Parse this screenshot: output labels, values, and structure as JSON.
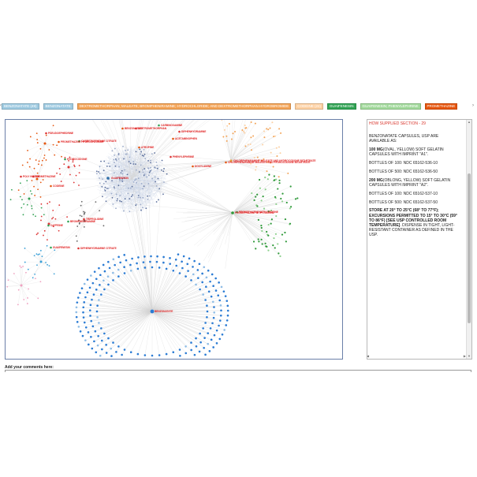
{
  "tags": [
    {
      "label": "BENZONATATE (49)",
      "color": "#9ecae1"
    },
    {
      "label": "BENZONATATE",
      "color": "#9ecae1"
    },
    {
      "label": "DEXTROMETHORPHAN; MALEATE; BROMPHENIRAMINE; HYDROCHLORIDE; AND DEXTROMETHORPHAN HYDROBROMIDE",
      "color": "#f3a356"
    },
    {
      "label": "CODEINE (22)",
      "color": "#fdd0a2"
    },
    {
      "label": "GUAIFENESIN",
      "color": "#31a354"
    },
    {
      "label": "GUAIFENESIN; PHENYLEPHRINE",
      "color": "#a1d99b"
    },
    {
      "label": "PROMETHAZINE",
      "color": "#e6550d"
    }
  ],
  "graph": {
    "hubs": [
      {
        "id": "h_benzo",
        "label": "BENZONATATE",
        "color": "#2a7bd4"
      },
      {
        "id": "h_guai",
        "label": "GUAIFENESIN",
        "color": "#2f6fa8"
      },
      {
        "id": "h_prom_cod",
        "label": "PROMETHAZINE WITH CODEINE",
        "color": "#2f9a3a"
      },
      {
        "id": "h_chlor",
        "label": "CHLORPHENIRAMINE MALEATE AND HYDROCODONE BITARTRATE",
        "color": "#e6a23c"
      },
      {
        "id": "h_cod",
        "label": "CODEINE",
        "color": "#e6a23c"
      },
      {
        "id": "h_pheno",
        "label": "PHENOBARBITAL",
        "color": "#d33"
      }
    ],
    "labels": [
      "PSEUDOEPHEDRINE",
      "PROMETHAZINE HYDROCHLORIDE",
      "CARBETAPENTANE CITRATE",
      "DEXTROMETHORPHAN",
      "BENZONATATE",
      "CARBINOXAMINE",
      "DIPHENHYDRAMINE",
      "ACETAMINOPHEN",
      "HYDROCODONE",
      "PROMETHAZINE",
      "CODEINE",
      "BROMPHENIRAMINE",
      "TRIPROLIDINE",
      "CHLORPHENIRAMINE MALEATE AND HYDROCODONE BITARTRATE",
      "PROMETHAZINE WITH CODEINE",
      "PHENYLEPHRINE",
      "DOXYLAMINE",
      "GUAIFENESIN",
      "DIPHENHYDRAMINE CITRATE",
      "ATROPINE",
      "CAFFEINE",
      "POLY HISTINE"
    ]
  },
  "panel": {
    "section_title": "HOW SUPPLIED SECTION - 29",
    "paragraphs": [
      {
        "bold": "",
        "text": "BENZONATATE CAPSULES, USP ARE AVAILABLE AS:"
      },
      {
        "bold": "100 MG",
        "text": "(OVAL, YELLOW) SOFT GELATIN CAPSULES WITH IMPRINT \"A1\"."
      },
      {
        "bold": "",
        "text": "BOTTLES OF 100: NDC 65162-536-10"
      },
      {
        "bold": "",
        "text": "BOTTLES OF 500: NDC 65162-536-50"
      },
      {
        "bold": "200 MG",
        "text": "(OBLONG, YELLOW) SOFT GELATIN CAPSULES WITH IMPRINT \"A2\"."
      },
      {
        "bold": "",
        "text": "BOTTLES OF 100: NDC 65162-537-10"
      },
      {
        "bold": "",
        "text": "BOTTLES OF 500: NDC 65162-537-50"
      },
      {
        "bold": "STORE AT 20° TO 25°C (68° TO 77°F); EXCURSIONS PERMITTED TO 15° TO 30°C (59° TO 86°F) [SEE USP CONTROLLED ROOM TEMPERATURE]",
        "text": ". DISPENSE IN TIGHT, LIGHT-RESISTANT CONTAINER AS DEFINED IN THE USP."
      }
    ]
  },
  "comments": {
    "label": "Add your comments here:",
    "value": ""
  }
}
